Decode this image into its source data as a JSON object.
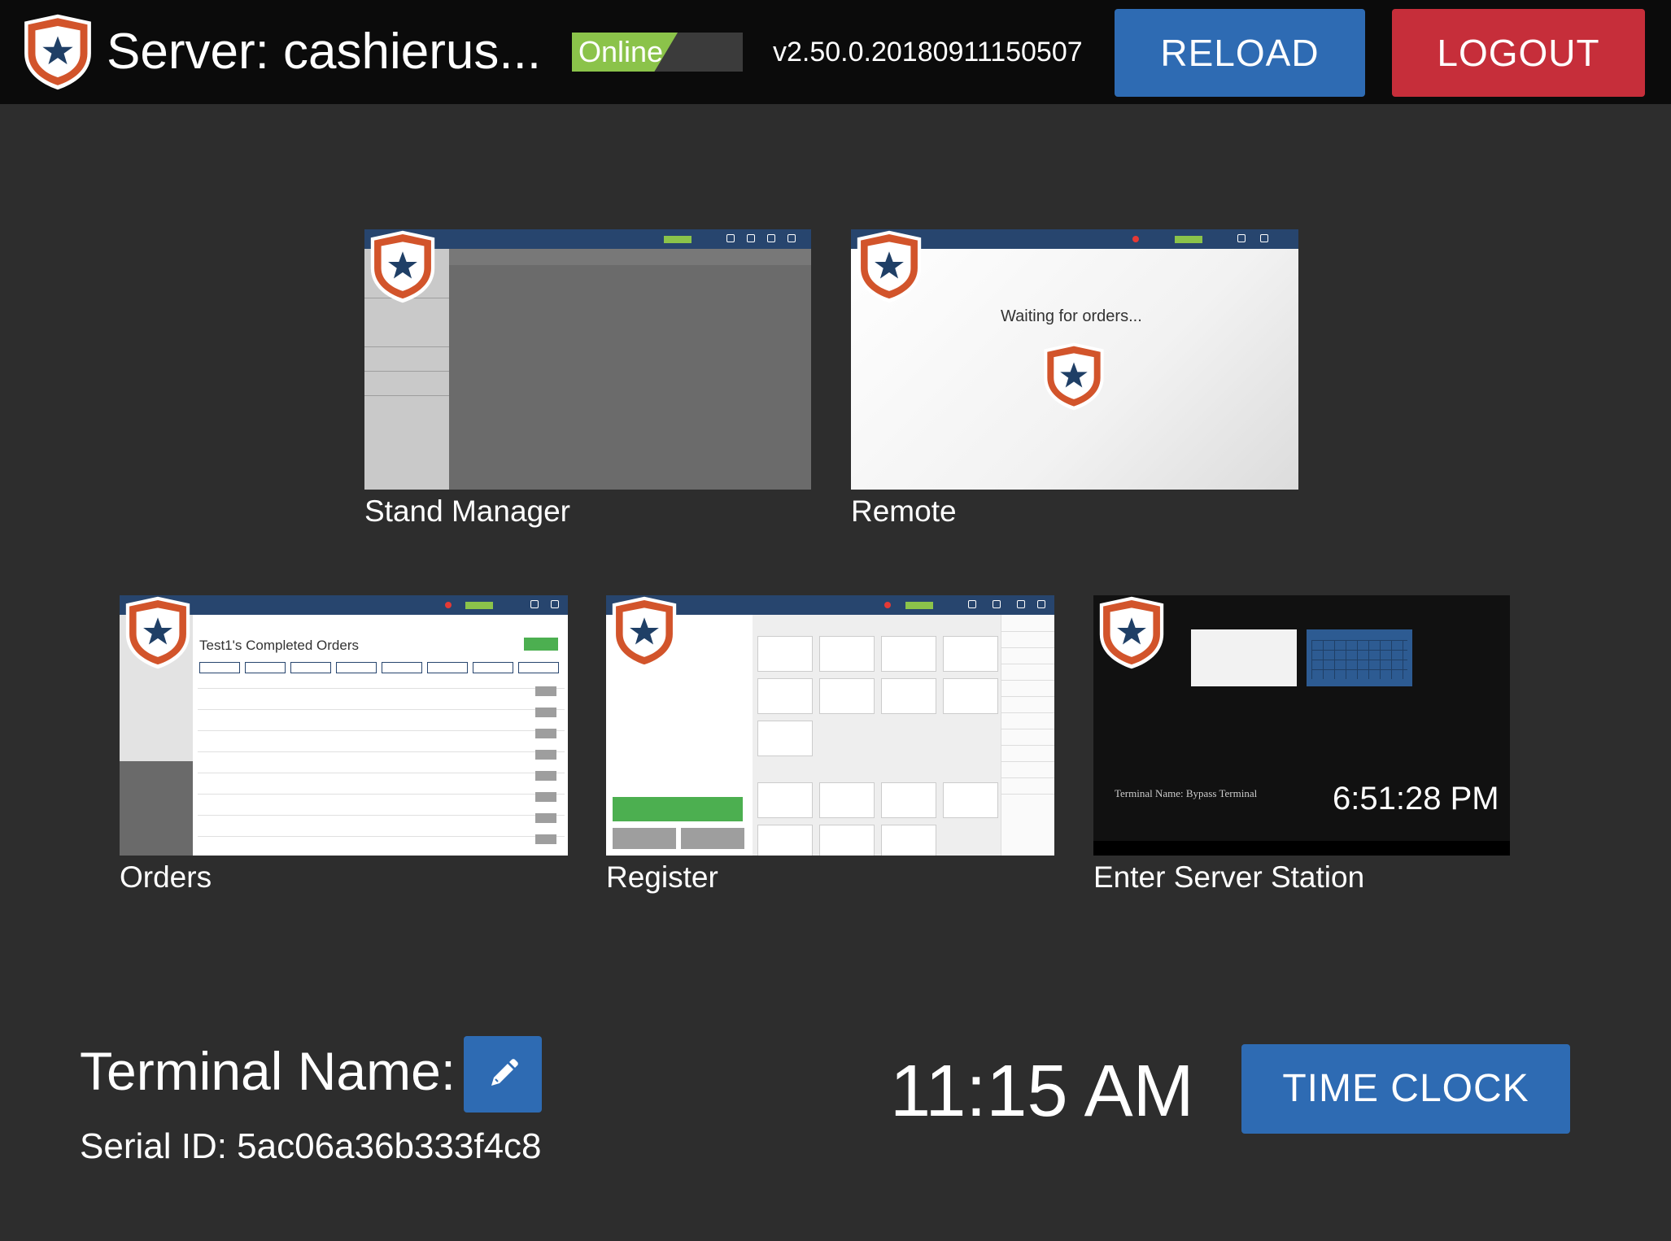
{
  "header": {
    "server_title": "Server: cashierus...",
    "status": "Online",
    "version": "v2.50.0.20180911150507",
    "reload_label": "RELOAD",
    "logout_label": "LOGOUT"
  },
  "apps": [
    {
      "label": "Stand Manager"
    },
    {
      "label": "Remote",
      "preview_text": "Waiting for orders..."
    },
    {
      "label": "Orders",
      "preview_heading": "Test1's Completed Orders"
    },
    {
      "label": "Register"
    },
    {
      "label": "Enter Server Station",
      "preview_clock": "6:51:28 PM",
      "preview_terminal": "Terminal Name: Bypass Terminal"
    }
  ],
  "terminal": {
    "name_label": "Terminal Name:",
    "serial": "Serial ID: 5ac06a36b333f4c8"
  },
  "clock": {
    "time": "11:15 AM",
    "time_clock_label": "TIME CLOCK"
  },
  "colors": {
    "header_bg": "#0b0b0b",
    "page_bg": "#2d2d2d",
    "reload_blue": "#2e6bb3",
    "logout_red": "#c62e3a",
    "online_green": "#8bc34a",
    "shield_orange": "#d2542b",
    "shield_star_navy": "#1f3f66"
  },
  "icons": [
    "shield-star-logo",
    "pencil-icon"
  ]
}
